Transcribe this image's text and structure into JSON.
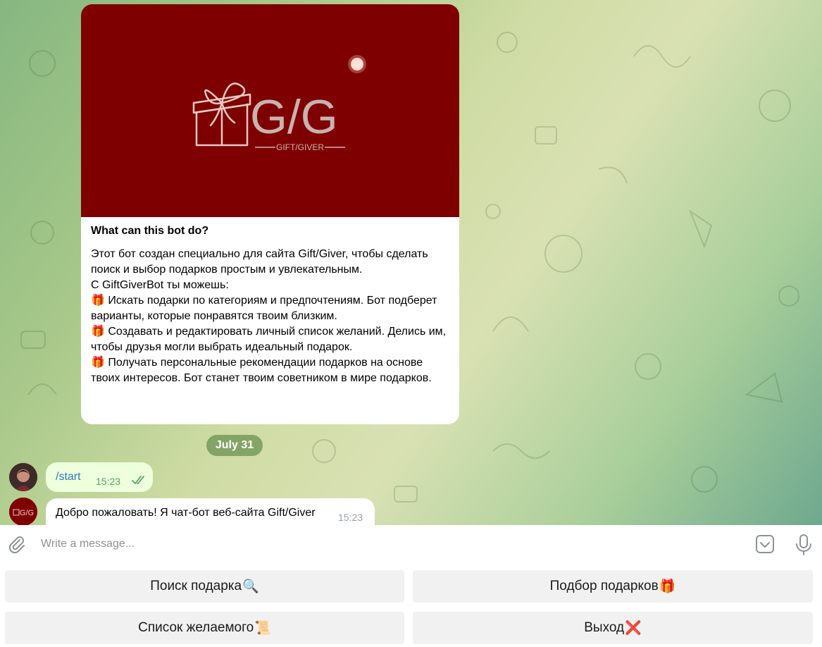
{
  "intro": {
    "title": "What can this bot do?",
    "text": "Этот бот создан специально для сайта Gift/Giver, чтобы сделать поиск и выбор подарков простым и увлекательным.\nС GiftGiverBot ты можешь:\n🎁 Искать подарки по категориям и предпочтениям. Бот подберет варианты, которые понравятся твоим близким.\n🎁 Создавать и редактировать личный список желаний. Делись им, чтобы друзья могли выбрать идеальный подарок.\n🎁 Получать персональные рекомендации подарков на основе твоих интересов. Бот станет твоим советником в мире подарков.",
    "logo_text": "G/G",
    "logo_subtitle": "GIFT/GIVER"
  },
  "date_separator": "July 31",
  "messages": [
    {
      "from": "user",
      "text": "/start",
      "time": "15:23",
      "status": "read"
    },
    {
      "from": "bot",
      "text": "Добро пожаловать! Я чат-бот веб-сайта Gift/Giver",
      "time": "15:23"
    }
  ],
  "bot_avatar_text": "G/G",
  "composer": {
    "placeholder": "Write a message..."
  },
  "keyboard": {
    "buttons": [
      {
        "label": "Поиск подарка",
        "emoji": "🔍"
      },
      {
        "label": "Подбор подарков",
        "emoji": "🎁"
      },
      {
        "label": "Список желаемого",
        "emoji": "📜"
      },
      {
        "label": "Выход",
        "emoji": "❌"
      }
    ]
  },
  "colors": {
    "banner": "#7f0000",
    "outgoing_bubble": "#eeffde",
    "link": "#2f7ab8",
    "date_pill": "#69914f"
  }
}
